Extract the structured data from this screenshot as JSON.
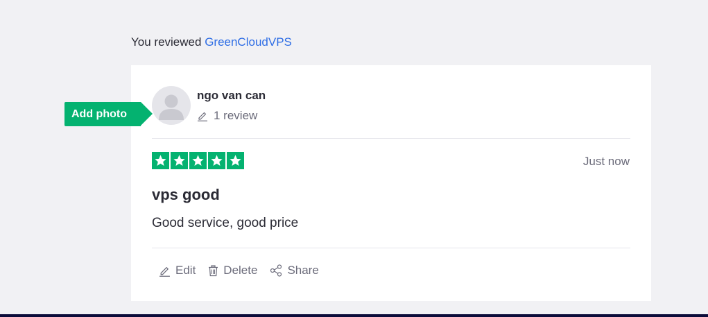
{
  "header": {
    "prefix": "You reviewed",
    "company": "GreenCloudVPS"
  },
  "add_photo": {
    "label": "Add photo"
  },
  "user": {
    "name": "ngo van can",
    "review_count": "1 review",
    "avatar_icon": "user-silhouette-icon"
  },
  "review": {
    "rating": 5,
    "max_rating": 5,
    "timestamp": "Just now",
    "title": "vps good",
    "body": "Good service, good price"
  },
  "actions": {
    "edit": "Edit",
    "delete": "Delete",
    "share": "Share"
  },
  "colors": {
    "accent_green": "#04b270",
    "link_blue": "#2f6ee5",
    "background": "#f1f1f4",
    "muted_text": "#6b6b7a"
  }
}
